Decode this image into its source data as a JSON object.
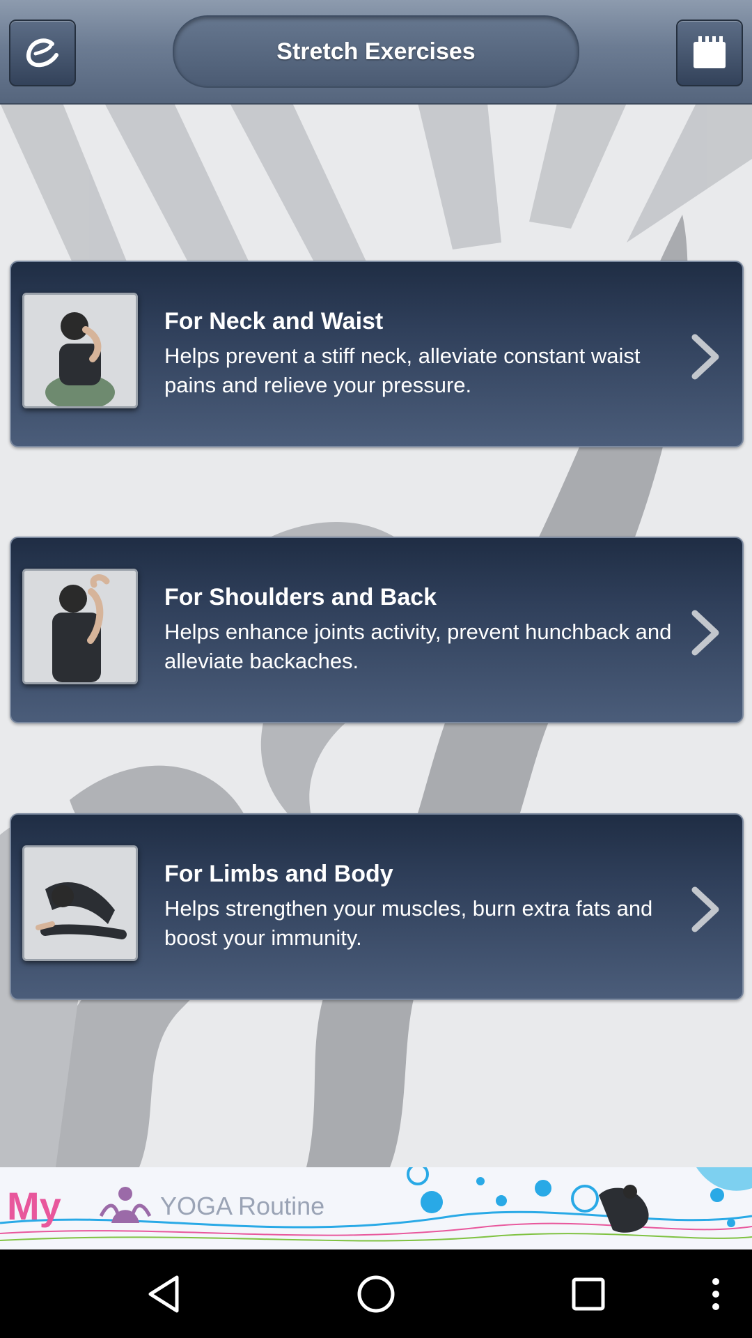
{
  "header": {
    "title": "Stretch Exercises",
    "left_icon": "refresh-e-icon",
    "right_icon": "calendar-icon"
  },
  "exercises": [
    {
      "title": "For Neck and Waist",
      "description": "Helps prevent a stiff neck, alleviate constant waist pains and relieve your pressure."
    },
    {
      "title": "For Shoulders and Back",
      "description": "Helps enhance joints activity, prevent hunchback and alleviate backaches."
    },
    {
      "title": "For Limbs and Body",
      "description": "Helps strengthen your muscles, burn extra fats and boost your immunity."
    }
  ],
  "ad": {
    "text_my": "My",
    "text_rest": "YOGA Routine"
  },
  "navbar": {
    "items": [
      "back-icon",
      "home-icon",
      "recents-icon",
      "more-icon"
    ]
  },
  "colors": {
    "header": "#6c7c93",
    "card": "#2f3f5a",
    "background": "#e9eaec",
    "ad_pink": "#e8579c",
    "ad_blue": "#29a9e6"
  }
}
